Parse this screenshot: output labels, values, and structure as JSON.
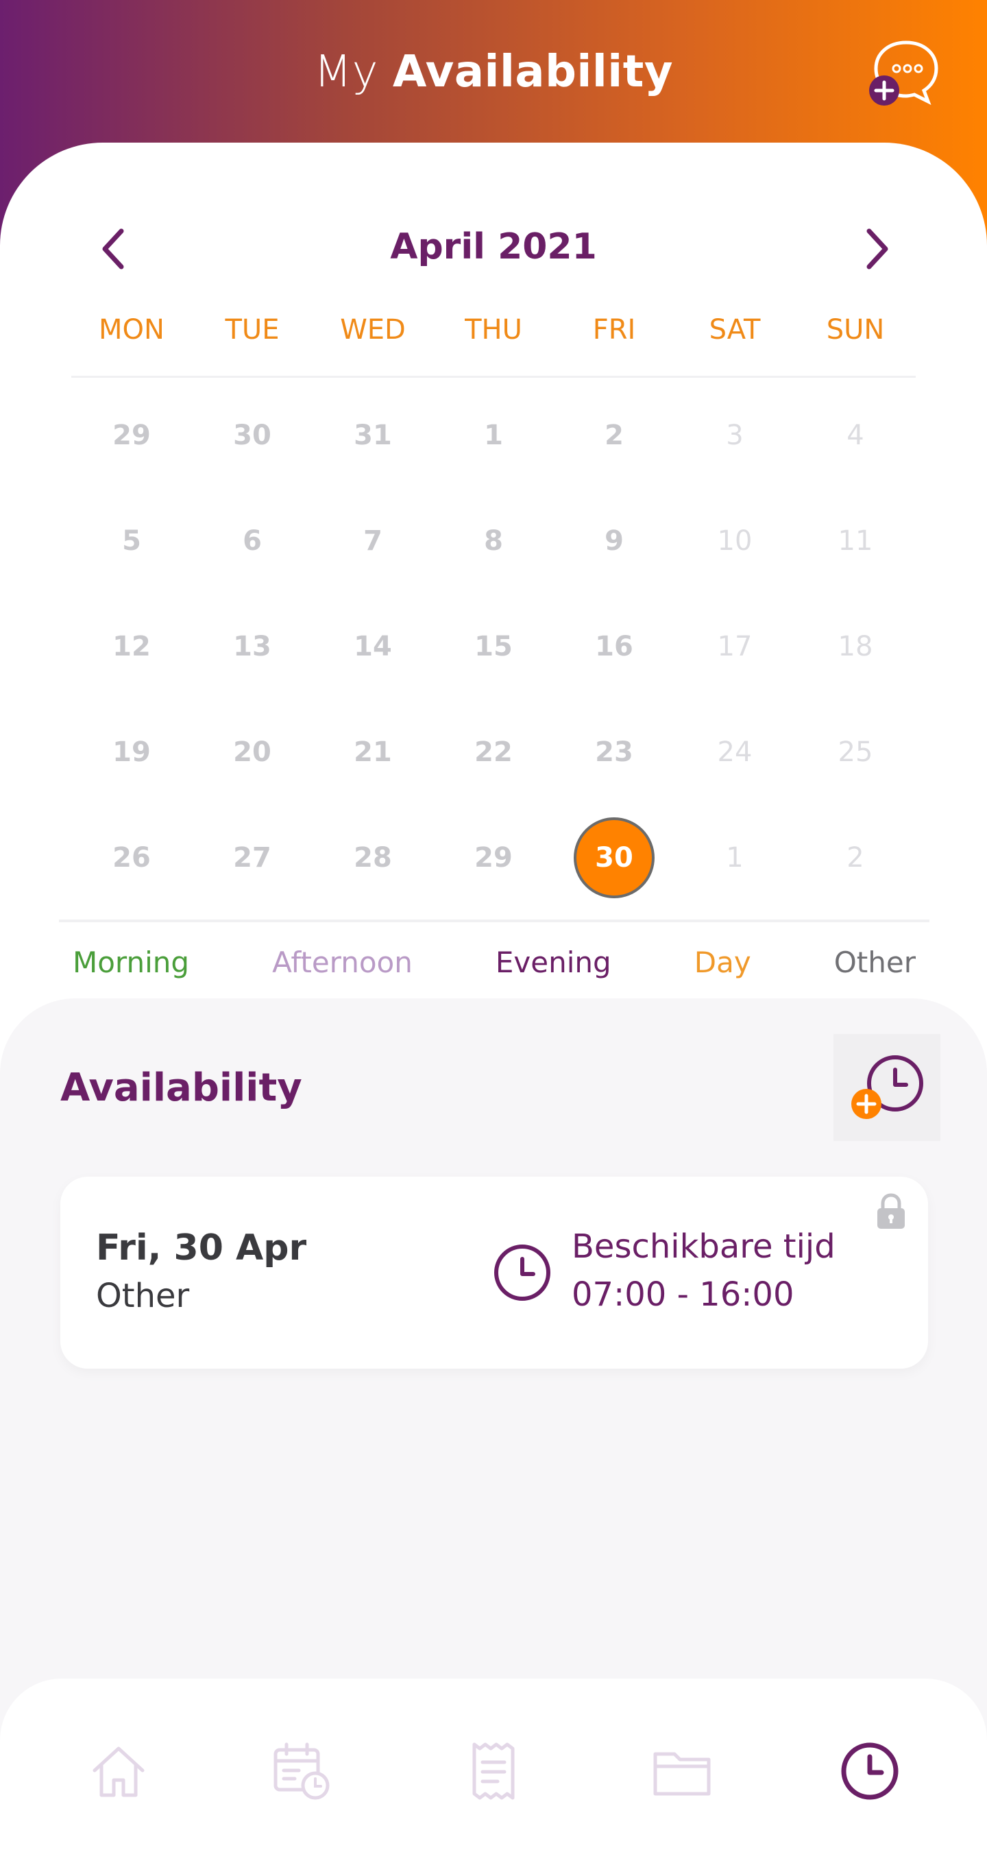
{
  "header": {
    "title_light": "My",
    "title_bold": "Availability",
    "chat_icon": "chat-add-icon"
  },
  "calendar": {
    "month_label": "April 2021",
    "prev_icon": "chevron-left-icon",
    "next_icon": "chevron-right-icon",
    "weekdays": [
      "MON",
      "TUE",
      "WED",
      "THU",
      "FRI",
      "SAT",
      "SUN"
    ],
    "weeks": [
      [
        "29",
        "30",
        "31",
        "1",
        "2",
        "3",
        "4"
      ],
      [
        "5",
        "6",
        "7",
        "8",
        "9",
        "10",
        "11"
      ],
      [
        "12",
        "13",
        "14",
        "15",
        "16",
        "17",
        "18"
      ],
      [
        "19",
        "20",
        "21",
        "22",
        "23",
        "24",
        "25"
      ],
      [
        "26",
        "27",
        "28",
        "29",
        "30",
        "1",
        "2"
      ]
    ],
    "selected": "30"
  },
  "legend": {
    "morning": "Morning",
    "afternoon": "Afternoon",
    "evening": "Evening",
    "day": "Day",
    "other": "Other"
  },
  "availability": {
    "title": "Availability",
    "add_icon": "add-time-icon",
    "entries": [
      {
        "date": "Fri, 30 Apr",
        "type": "Other",
        "label": "Beschikbare tijd",
        "time": "07:00 - 16:00",
        "locked": true
      }
    ]
  },
  "bottom_nav": {
    "items": [
      "home-icon",
      "schedule-icon",
      "receipt-icon",
      "folder-icon",
      "clock-icon"
    ],
    "active": "clock-icon"
  },
  "colors": {
    "primary": "#6a1f66",
    "accent": "#ff8200",
    "morning": "#4a9e3a",
    "afternoon": "#b99ac6",
    "day": "#f0992a",
    "other": "#707074"
  }
}
